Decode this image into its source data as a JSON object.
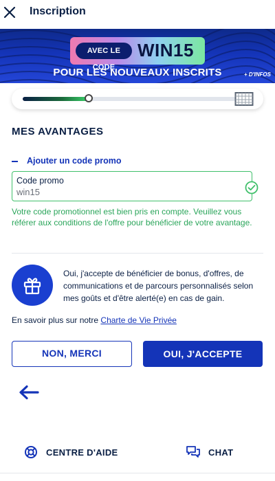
{
  "header": {
    "title": "Inscription",
    "close_icon": "close-icon"
  },
  "banner": {
    "pill_left": "AVEC LE CODE",
    "code": "WIN15",
    "subtitle": "POUR LES NOUVEAUX INSCRITS",
    "infos": "+ D'INFOS"
  },
  "progress": {
    "value": 0.31,
    "end_icon": "goal-net-icon"
  },
  "section": {
    "title": "MES AVANTAGES",
    "promo_toggle_label": "Ajouter un code promo"
  },
  "promo_field": {
    "label": "Code promo",
    "value": "win15",
    "status_icon": "check-circle-icon"
  },
  "success_message": "Votre code promotionnel est bien pris en compte. Veuillez vous référer aux conditions de l'offre pour bénéficier de votre avantage.",
  "consent": {
    "icon": "gift-icon",
    "text": "Oui, j'accepte de bénéficier de bonus, d'offres, de communications et de parcours personnalisés selon mes goûts et d'être alerté(e) en cas de gain."
  },
  "privacy": {
    "prefix": "En savoir plus sur notre ",
    "link": "Charte de Vie Privée"
  },
  "buttons": {
    "no": "NON, MERCI",
    "yes": "OUI, J'ACCEPTE"
  },
  "footer": {
    "help": "CENTRE D'AIDE",
    "chat": "CHAT"
  },
  "colors": {
    "brand": "#1434b8",
    "success": "#2aa55a",
    "navy": "#0a1f44"
  }
}
